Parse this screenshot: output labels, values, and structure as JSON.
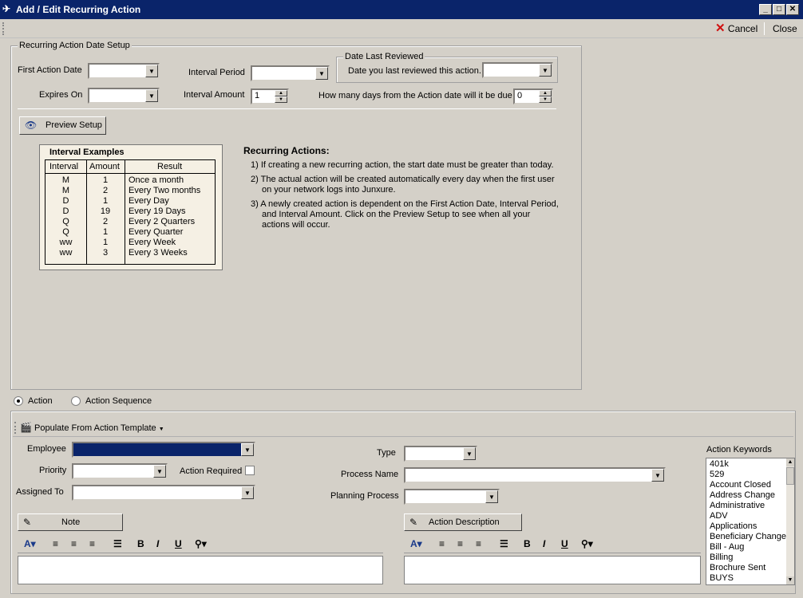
{
  "window": {
    "title": "Add / Edit Recurring Action"
  },
  "toolbar": {
    "cancel_label": "Cancel",
    "close_label": "Close"
  },
  "setup": {
    "group_title": "Recurring Action Date Setup",
    "first_action_date_label": "First Action Date",
    "first_action_date_value": "",
    "expires_on_label": "Expires On",
    "expires_on_value": "",
    "interval_period_label": "Interval Period",
    "interval_period_value": "",
    "interval_amount_label": "Interval Amount",
    "interval_amount_value": "1",
    "date_last_reviewed_title": "Date Last Reviewed",
    "date_last_reviewed_label": "Date you last reviewed this action.",
    "date_last_reviewed_value": "",
    "due_days_label": "How many days from the Action date will it be due",
    "due_days_value": "0",
    "preview_button": "Preview Setup"
  },
  "examples": {
    "title": "Interval Examples",
    "headers": [
      "Interval",
      "Amount",
      "Result"
    ],
    "rows": [
      [
        "M",
        "1",
        "Once a month"
      ],
      [
        "M",
        "2",
        "Every Two months"
      ],
      [
        "D",
        "1",
        "Every Day"
      ],
      [
        "D",
        "19",
        "Every 19 Days"
      ],
      [
        "Q",
        "2",
        "Every 2 Quarters"
      ],
      [
        "Q",
        "1",
        "Every Quarter"
      ],
      [
        "ww",
        "1",
        "Every Week"
      ],
      [
        "ww",
        "3",
        "Every 3 Weeks"
      ]
    ]
  },
  "notes": {
    "title": "Recurring Actions:",
    "items": [
      [
        "1) If creating a new recurring action, the start date must be greater than today."
      ],
      [
        "2) The actual action will be created automatically every day when the first user",
        "on your network logs into Junxure."
      ],
      [
        "3) A newly created action is dependent on the First Action Date, Interval Period,",
        "and Interval Amount.  Click on the Preview Setup to see when all your",
        "actions will occur."
      ]
    ]
  },
  "mode": {
    "action_label": "Action",
    "sequence_label": "Action Sequence",
    "selected": "Action"
  },
  "action": {
    "populate_label": "Populate From Action Template",
    "employee_label": "Employee",
    "employee_value": "",
    "priority_label": "Priority",
    "priority_value": "",
    "action_required_label": "Action Required",
    "assigned_to_label": "Assigned To",
    "assigned_to_value": "",
    "type_label": "Type",
    "type_value": "",
    "process_name_label": "Process Name",
    "process_name_value": "",
    "planning_process_label": "Planning Process",
    "planning_process_value": "",
    "note_button": "Note",
    "description_button": "Action Description",
    "keywords_label": "Action Keywords",
    "keywords": [
      "401k",
      "529",
      "Account Closed",
      "Address Change",
      "Administrative",
      "ADV",
      "Applications",
      "Beneficiary Change",
      "Bill - Aug",
      "Billing",
      "Brochure Sent",
      "BUYS"
    ]
  },
  "colors": {
    "titlebar": "#0a246a",
    "selection": "#0a246a",
    "face": "#d4d0c8"
  }
}
